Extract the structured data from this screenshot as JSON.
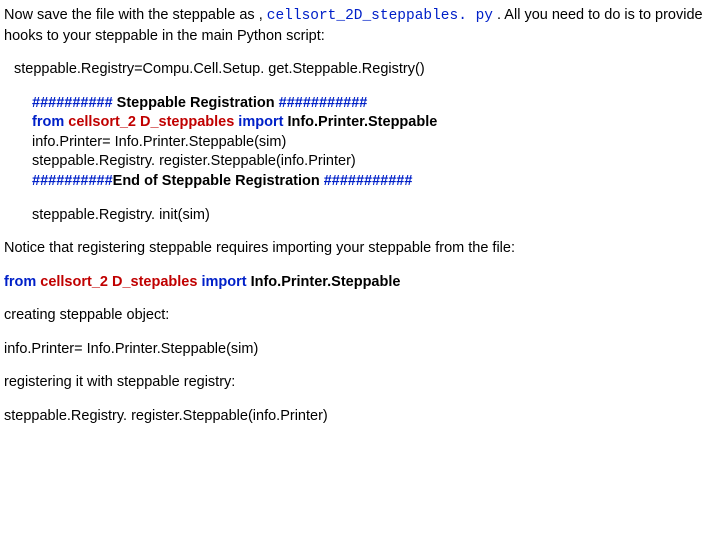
{
  "intro": {
    "part1": "Now save the file with the steppable as ,",
    "filename": "cellsort_2D_steppables. py",
    "part2": " . All you need to do is to provide hooks to your steppable in the main Python script:"
  },
  "line_registry_get": "steppable.Registry=Compu.Cell.Setup. get.Steppable.Registry()",
  "reg": {
    "open1": "##########",
    "open2": " Steppable Registration ",
    "open3": "###########",
    "from": "from ",
    "module": "cellsort_2 D_steppables",
    "import": " import",
    "class": " Info.Printer.Steppable",
    "l3": "info.Printer= Info.Printer.Steppable(sim)",
    "l4": "steppable.Registry. register.Steppable(info.Printer)",
    "close1": "##########",
    "close2": "End of  Steppable Registration ",
    "close3": "###########"
  },
  "line_init": "steppable.Registry. init(sim)",
  "notice": "Notice that registering steppable requires importing your steppable from the file:",
  "imp": {
    "from": "from ",
    "module": "cellsort_2 D_stepables",
    "import": " import",
    "class": " Info.Printer.Steppable"
  },
  "creating": "creating steppable object:",
  "obj_line": "info.Printer= Info.Printer.Steppable(sim)",
  "registering": "registering it with steppable registry:",
  "reg_line": "steppable.Registry. register.Steppable(info.Printer)"
}
